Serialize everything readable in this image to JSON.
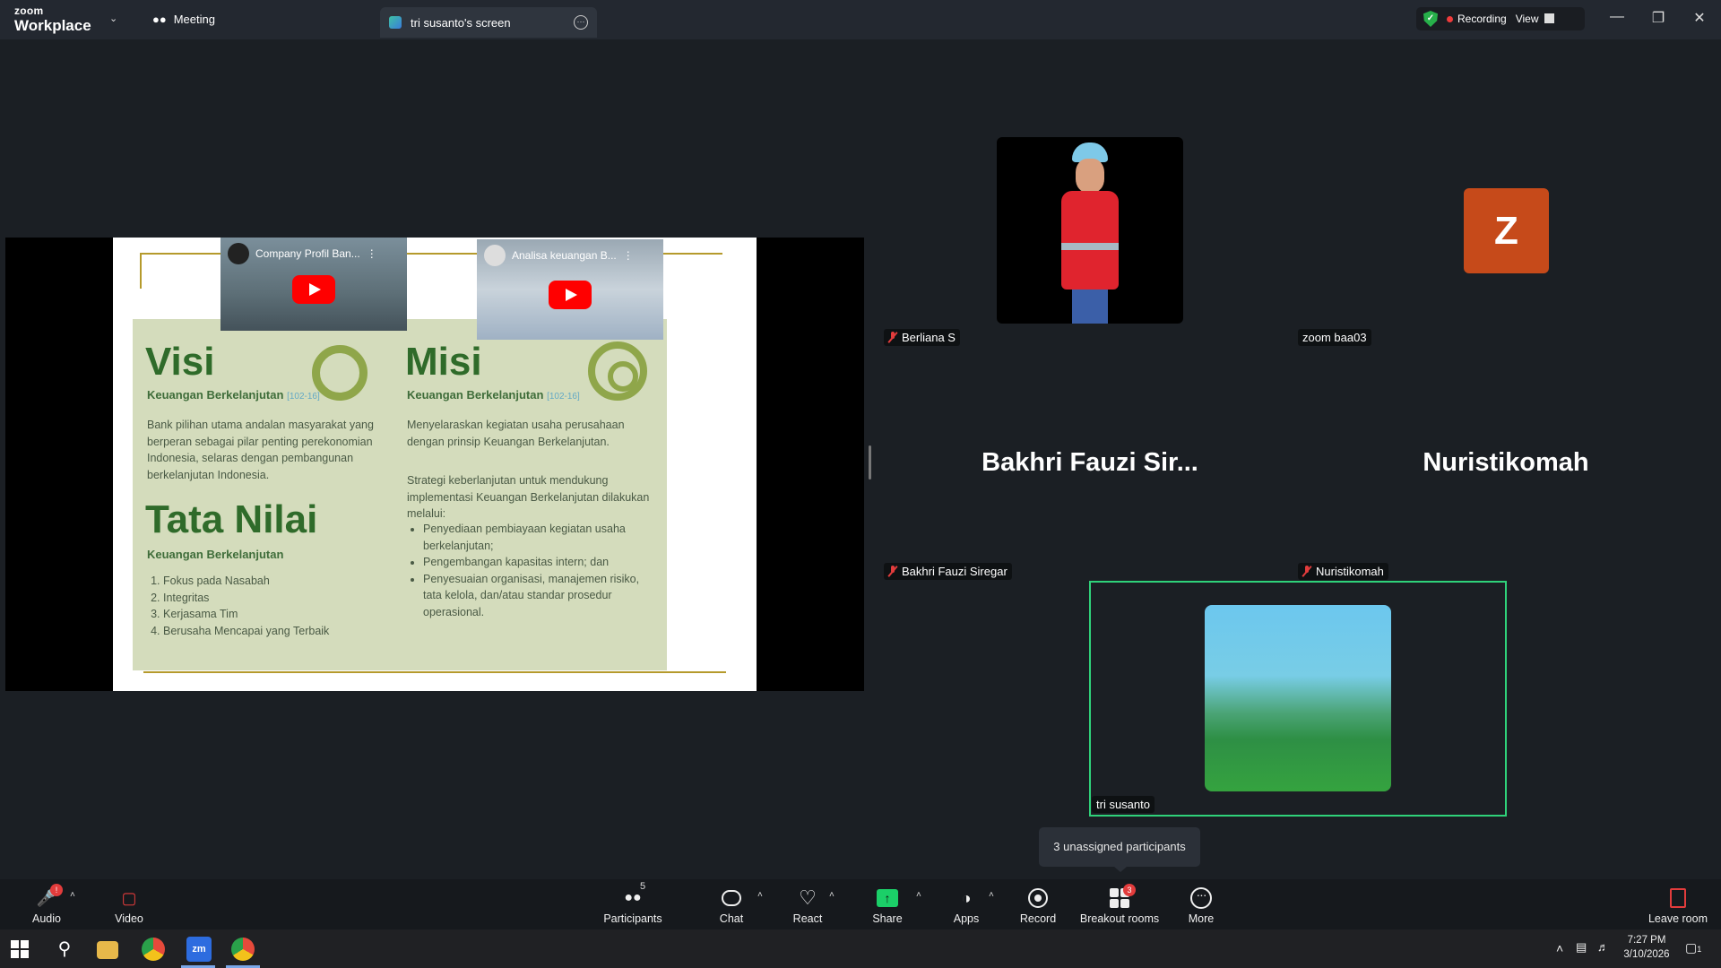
{
  "titlebar": {
    "brand_top": "zoom",
    "brand_bottom": "Workplace",
    "meeting_tab": "Meeting",
    "screen_tab": "tri susanto's screen",
    "recording_label": "Recording",
    "view_label": "View"
  },
  "shared_screen": {
    "video1_title": "Company Profil Ban...",
    "video2_title": "Analisa keuangan B...",
    "visi_title": "Visi",
    "misi_title": "Misi",
    "sub_label": "Keuangan Berkelanjutan",
    "ref": "[102-16]",
    "visi_text": "Bank pilihan utama andalan masyarakat yang berperan sebagai pilar penting perekonomian Indonesia, selaras dengan pembangunan berkelanjutan Indonesia.",
    "tata_title": "Tata Nilai",
    "tata_items": [
      "Fokus pada Nasabah",
      "Integritas",
      "Kerjasama Tim",
      "Berusaha Mencapai yang Terbaik"
    ],
    "misi_text": "Menyelaraskan kegiatan usaha perusahaan dengan prinsip Keuangan Berkelanjutan.",
    "strategi_text": "Strategi keberlanjutan untuk mendukung implementasi Keuangan Berkelanjutan dilakukan melalui:",
    "strategi_items": [
      "Penyediaan pembiayaan kegiatan usaha berkelanjutan;",
      "Pengembangan kapasitas intern; dan",
      "Penyesuaian organisasi, manajemen risiko, tata kelola, dan/atau standar prosedur operasional."
    ]
  },
  "participants": {
    "berliana": "Berliana S",
    "zoom_baa03": "zoom baa03",
    "avatar_letter": "Z",
    "bakhri_big": "Bakhri Fauzi Sir...",
    "bakhri": "Bakhri Fauzi Siregar",
    "nuris_big": "Nuristikomah",
    "nuris": "Nuristikomah",
    "tri": "tri susanto"
  },
  "tooltip": "3 unassigned participants",
  "toolbar": {
    "audio": "Audio",
    "audio_badge": "!",
    "video": "Video",
    "participants": "Participants",
    "participants_count": "5",
    "chat": "Chat",
    "react": "React",
    "share": "Share",
    "apps": "Apps",
    "record": "Record",
    "breakout": "Breakout rooms",
    "breakout_badge": "3",
    "more": "More",
    "leave": "Leave room"
  },
  "taskbar": {
    "time": "7:27 PM",
    "date": "3/10/2026",
    "notif_count": "1"
  },
  "colors": {
    "share_green": "#1bcf68",
    "active_border": "#2fd27a",
    "record_red": "#ef3b3b",
    "avatar_orange": "#c64a1a"
  }
}
